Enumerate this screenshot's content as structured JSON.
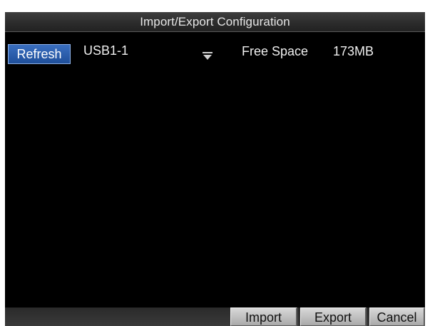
{
  "window": {
    "title": "Import/Export Configuration"
  },
  "toolbar": {
    "refresh_label": "Refresh",
    "device_selected": "USB1-1",
    "free_space_label": "Free Space",
    "free_space_value": "173MB"
  },
  "footer": {
    "import_label": "Import",
    "export_label": "Export",
    "cancel_label": "Cancel"
  },
  "icons": {
    "dropdown": "chevron-down-icon"
  },
  "colors": {
    "background": "#000000",
    "accent": "#2a5cab",
    "text": "#f0f0f0"
  }
}
